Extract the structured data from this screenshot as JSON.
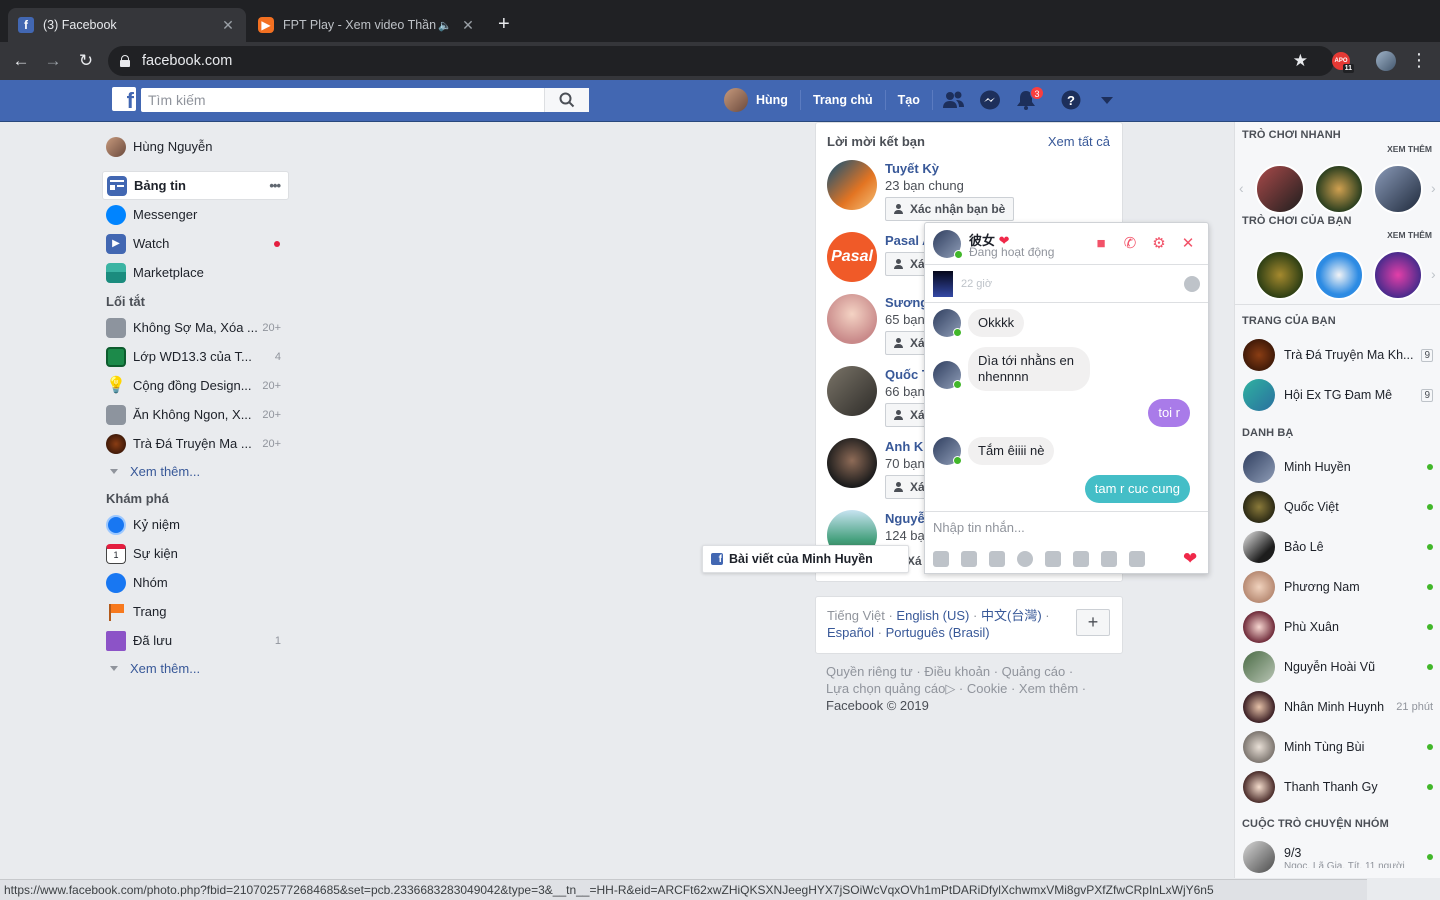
{
  "browser": {
    "tabs": [
      {
        "title": "(3) Facebook",
        "favicon": "facebook-icon",
        "active": true
      },
      {
        "title": "FPT Play - Xem video Thần",
        "favicon": "fpt-play-icon",
        "active": false,
        "audio": true
      }
    ],
    "url": "facebook.com",
    "extension_badge": "11",
    "extension_label": "APO",
    "status_url": "https://www.facebook.com/photo.php?fbid=2107025772684685&set=pcb.2336683283049042&type=3&__tn__=HH-R&eid=ARCFt62xwZHiQKSXNJeegHYX7jSOiWcVqxOVh1mPtDARiDfylXchwmxVMi8gvPXfZfwCRpInLxWjY6n5"
  },
  "fb_header": {
    "search_placeholder": "Tìm kiếm",
    "profile_name": "Hùng",
    "home_label": "Trang chủ",
    "create_label": "Tạo",
    "notification_count": "3"
  },
  "left_nav": {
    "user_name": "Hùng Nguyễn",
    "main": [
      {
        "label": "Bảng tin",
        "icon": "news-feed-icon"
      },
      {
        "label": "Messenger",
        "icon": "messenger-icon"
      },
      {
        "label": "Watch",
        "icon": "watch-icon"
      },
      {
        "label": "Marketplace",
        "icon": "marketplace-icon"
      }
    ],
    "more_dots": "•••",
    "shortcuts_header": "Lối tắt",
    "shortcuts": [
      {
        "label": "Không Sợ Ma, Xóa ...",
        "count": "20+"
      },
      {
        "label": "Lớp WD13.3 của T...",
        "count": "4"
      },
      {
        "label": "Cộng đồng Design...",
        "count": "20+"
      },
      {
        "label": "Ăn Không Ngon, X...",
        "count": "20+"
      },
      {
        "label": "Trà Đá Truyện Ma ...",
        "count": "20+"
      }
    ],
    "see_more": "Xem thêm...",
    "explore_header": "Khám phá",
    "explore": [
      {
        "label": "Kỷ niệm",
        "count": ""
      },
      {
        "label": "Sự kiện",
        "count": ""
      },
      {
        "label": "Nhóm",
        "count": ""
      },
      {
        "label": "Trang",
        "count": ""
      },
      {
        "label": "Đã lưu",
        "count": "1"
      }
    ],
    "see_more_2": "Xem thêm..."
  },
  "friend_requests": {
    "title": "Lời mời kết bạn",
    "see_all": "Xem tất cả",
    "confirm_label": "Xác nhận bạn bè",
    "partial_confirm_label": "Xá",
    "items": [
      {
        "name": "Tuyết Kỳ",
        "mutual": "23 bạn chung"
      },
      {
        "name": "Pasal A",
        "mutual": ""
      },
      {
        "name": "Sương",
        "mutual": "65 bạn"
      },
      {
        "name": "Quốc T",
        "mutual": "66 bạn"
      },
      {
        "name": "Anh Kh",
        "mutual": "70 bạn"
      },
      {
        "name": "Nguyễ",
        "mutual": "124 bạ"
      }
    ]
  },
  "hover_tooltip": "Bài viết của Minh Huyền",
  "languages": {
    "current": "Tiếng Việt",
    "sep": "·",
    "options": [
      "English (US)",
      "中文(台灣)",
      "Español",
      "Português (Brasil)"
    ],
    "plus": "+"
  },
  "footer": {
    "links": [
      "Quyền riêng tư",
      "Điều khoản",
      "Quảng cáo",
      "Lựa chọn quảng cáo",
      "Cookie",
      "Xem thêm"
    ],
    "copyright": "Facebook © 2019"
  },
  "chat": {
    "name": "彼女",
    "heart": "❤",
    "status": "Đang hoạt động",
    "pinned_time": "22 giờ",
    "messages": [
      {
        "text": "Okkkk",
        "dir": "in"
      },
      {
        "text": "Dìa tới nhằns en nhennnn",
        "dir": "in"
      },
      {
        "text": "toi r",
        "dir": "out"
      },
      {
        "text": "Tắm êiiii nè",
        "dir": "in"
      },
      {
        "text": "tam r cuc cung",
        "dir": "out"
      }
    ],
    "input_placeholder": "Nhập tin nhắn...",
    "colors": {
      "accent": "#f25268",
      "out1": "#a97be9",
      "out2": "#44bec7"
    }
  },
  "right_sidebar": {
    "quick_games": "TRÒ CHƠI NHANH",
    "see_more": "XEM THÊM",
    "your_games": "TRÒ CHƠI CỦA BẠN",
    "your_pages": "TRANG CỦA BẠN",
    "pages": [
      {
        "name": "Trà Đá Truyện Ma Kh...",
        "badge": "9"
      },
      {
        "name": "Hội Ex TG Đam Mê",
        "badge": "9"
      }
    ],
    "contacts_header": "DANH BẠ",
    "contacts": [
      {
        "name": "Minh Huyền",
        "status": "online"
      },
      {
        "name": "Quốc Việt",
        "status": "online"
      },
      {
        "name": "Bảo Lê",
        "status": "online"
      },
      {
        "name": "Phương Nam",
        "status": "online"
      },
      {
        "name": "Phù Xuân",
        "status": "online"
      },
      {
        "name": "Nguyễn Hoài Vũ",
        "status": "online"
      },
      {
        "name": "Nhân Minh Huynh",
        "status": "21 phút"
      },
      {
        "name": "Minh Tùng Bùi",
        "status": "online"
      },
      {
        "name": "Thanh Thanh Gy",
        "status": "online"
      }
    ],
    "group_chats_header": "CUỘC TRÒ CHUYỆN NHÓM",
    "group_chat_name": "9/3",
    "group_chat_sub": "Ngọc, Lã Gia, Tít, 11 người"
  }
}
